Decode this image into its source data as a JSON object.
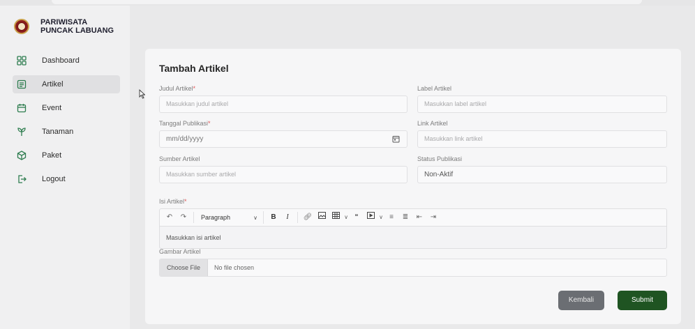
{
  "brand": {
    "name": "PARIWISATA PUNCAK LABUANG"
  },
  "sidebar": {
    "items": [
      {
        "label": "Dashboard",
        "icon": "dashboard-icon",
        "active": false
      },
      {
        "label": "Artikel",
        "icon": "article-icon",
        "active": true
      },
      {
        "label": "Event",
        "icon": "calendar-icon",
        "active": false
      },
      {
        "label": "Tanaman",
        "icon": "plant-icon",
        "active": false
      },
      {
        "label": "Paket",
        "icon": "package-icon",
        "active": false
      },
      {
        "label": "Logout",
        "icon": "logout-icon",
        "active": false
      }
    ]
  },
  "form": {
    "title": "Tambah Artikel",
    "judul": {
      "label": "Judul Artikel",
      "required": "*",
      "placeholder": "Masukkan judul artikel"
    },
    "label_artikel": {
      "label": "Label Artikel",
      "placeholder": "Masukkan label artikel"
    },
    "tanggal": {
      "label": "Tanggal Publikasi",
      "required": "*",
      "placeholder": "mm/dd/yyyy"
    },
    "link": {
      "label": "Link Artikel",
      "placeholder": "Masukkan link artikel"
    },
    "sumber": {
      "label": "Sumber Artikel",
      "placeholder": "Masukkan sumber artikel"
    },
    "status": {
      "label": "Status Publikasi",
      "value": "Non-Aktif"
    },
    "isi": {
      "label": "Isi Artikel",
      "required": "*",
      "placeholder": "Masukkan isi artikel",
      "paragraph": "Paragraph"
    },
    "gambar": {
      "label": "Gambar Artikel",
      "choose": "Choose File",
      "nofile": "No file chosen"
    },
    "back_label": "Kembali",
    "submit_label": "Submit"
  },
  "colors": {
    "accent": "#1f5422",
    "secondary": "#6b6e73",
    "brand": "#8a1c1c",
    "required": "#e05555"
  }
}
